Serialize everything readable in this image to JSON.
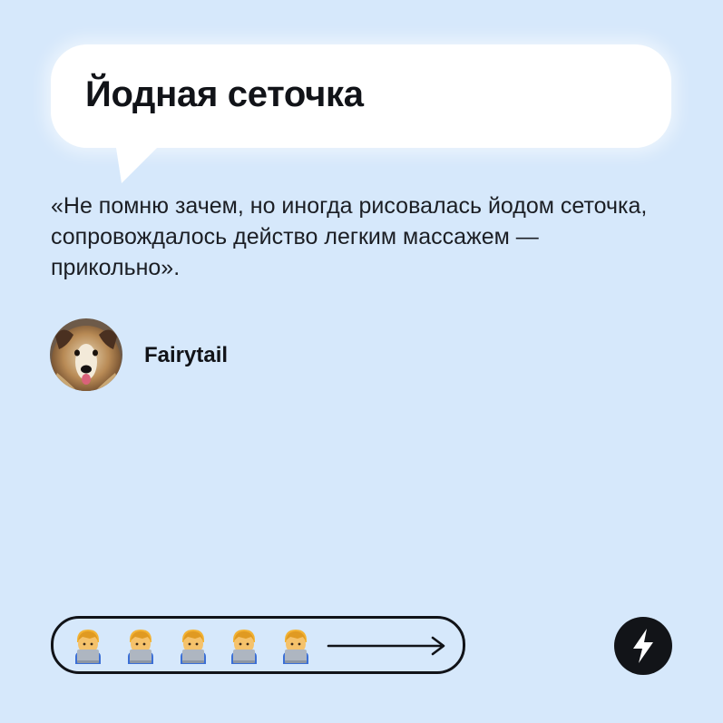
{
  "card": {
    "title": "Йодная сеточка",
    "quote": "«Не помню зачем, но иногда рисовалась йодом сеточка, сопровождалось действо легким массажем — прикольно».",
    "author": {
      "name": "Fairytail",
      "avatar_icon": "collie-dog-avatar"
    }
  },
  "progress": {
    "steps_icon": "technologist-emoji",
    "steps_count": 5,
    "arrow_icon": "right-arrow-icon"
  },
  "brand": {
    "logo_icon": "lightning-bolt-icon"
  },
  "colors": {
    "background": "#d6e8fb",
    "bubble": "#ffffff",
    "text": "#111318",
    "logo": "#121418"
  }
}
